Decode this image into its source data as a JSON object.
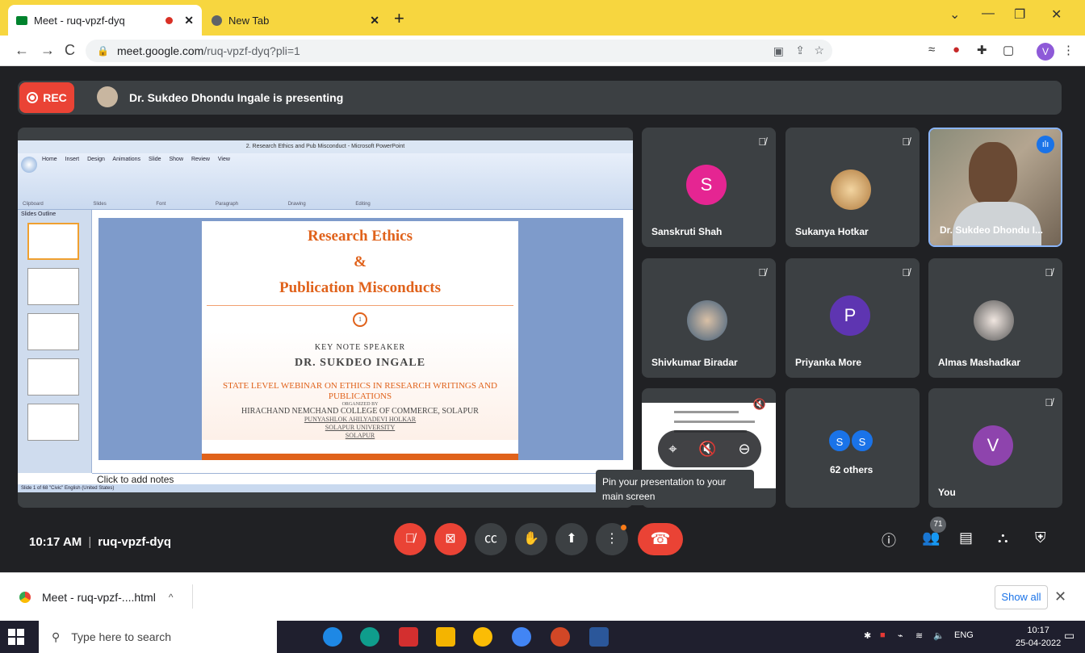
{
  "browser": {
    "tabs": [
      {
        "title": "Meet - ruq-vpzf-dyq",
        "recording": true
      },
      {
        "title": "New Tab"
      }
    ],
    "new_tab_label": "+",
    "url_host": "meet.google.com",
    "url_path": "/ruq-vpzf-dyq?pli=1",
    "profile_initial": "V"
  },
  "meet": {
    "rec_label": "REC",
    "presenting_text": "Dr. Sukdeo Dhondu Ingale is presenting",
    "time": "10:17 AM",
    "meeting_code": "ruq-vpzf-dyq",
    "participant_count": "71",
    "tooltip": "Pin your presentation to your main screen",
    "participants": [
      {
        "name": "Sanskruti Shah",
        "initial": "S",
        "color": "#e52592",
        "muted": true
      },
      {
        "name": "Sukanya Hotkar",
        "muted": true
      },
      {
        "name": "Dr. Sukdeo Dhondu I...",
        "speaking": true
      },
      {
        "name": "Shivkumar Biradar",
        "muted": true
      },
      {
        "name": "Priyanka More",
        "initial": "P",
        "color": "#5e35b1",
        "muted": true
      },
      {
        "name": "Almas Mashadkar",
        "muted": true
      },
      {
        "name": "",
        "presentation": true
      },
      {
        "name": "62 others",
        "mini": [
          "S",
          "S"
        ]
      },
      {
        "name": "You",
        "initial": "V",
        "color": "#8e44ad",
        "muted": true
      }
    ]
  },
  "ppt": {
    "window_title": "2. Research Ethics and Pub Misconduct - Microsoft PowerPoint",
    "ribbon_tabs": "Home Insert Design Animations Slide Show Review View",
    "ribbon_groups": "Clipboard Slides Font Paragraph Drawing Editing",
    "panel_tabs": "Slides  Outline",
    "notes": "Click to add notes",
    "status": "Slide 1 of 68   \"Civic\"   English (United States)",
    "slide": {
      "title1": "Research Ethics",
      "amp": "&",
      "title2": "Publication Misconducts",
      "slide_num": "1",
      "keynote": "KEY NOTE SPEAKER",
      "speaker": "DR. SUKDEO INGALE",
      "webinar": "STATE LEVEL WEBINAR ON ETHICS IN RESEARCH WRITINGS AND PUBLICATIONS",
      "organized": "ORGANIZED BY",
      "college": "HIRACHAND NEMCHAND COLLEGE OF COMMERCE, SOLAPUR",
      "uni1": "PUNYASHLOK AHILYADEVI HOLKAR",
      "uni2": "SOLAPUR UNIVERSITY",
      "uni3": "SOLAPUR"
    }
  },
  "downloads": {
    "item": "Meet - ruq-vpzf-....html",
    "show_all": "Show all"
  },
  "taskbar": {
    "search_placeholder": "Type here to search",
    "lang": "ENG",
    "time": "10:17",
    "date": "25-04-2022"
  },
  "colors": {
    "chrome_tabbar": "#f7d63f",
    "meet_bg": "#202124",
    "tile_bg": "#3c4043",
    "danger": "#ea4335",
    "accent": "#1a73e8",
    "slide_orange": "#e0621b"
  }
}
